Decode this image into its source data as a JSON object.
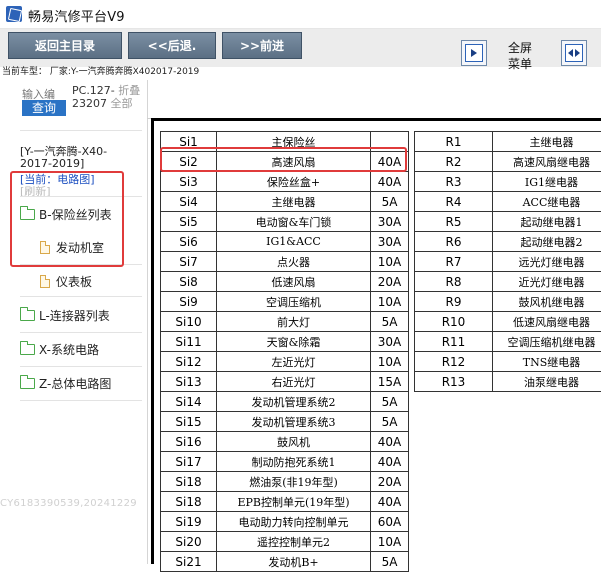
{
  "window": {
    "title": "畅易汽修平台V9"
  },
  "toolbar": {
    "back_main": "返回主目录",
    "back": "<<后退.",
    "forward": ">>前进",
    "fullscreen_line1": "全屏",
    "fullscreen_line2": "菜单"
  },
  "vehicle_line": "当前车型： 厂家:Y-一汽奔腾奔腾X402017-2019",
  "left": {
    "input_label": "输入编",
    "query": "查询",
    "code_line1_a": "PC.127-",
    "code_line1_b": "折叠",
    "code_line2_a": "23207",
    "code_line2_b": "全部",
    "model": "[Y-一汽奔腾-X40-2017-2019]",
    "current_link": "[当前：电路图]",
    "refresh": "[刷新]",
    "tree": [
      {
        "label": "B-保险丝列表"
      },
      {
        "label": "发动机室"
      },
      {
        "label": "仪表板"
      },
      {
        "label": "L-连接器列表"
      },
      {
        "label": "X-系统电路"
      },
      {
        "label": "Z-总体电路图"
      }
    ],
    "watermark": "CY6183390539,20241229"
  },
  "fuse_table_left": [
    [
      "Si1",
      "主保险丝",
      ""
    ],
    [
      "Si2",
      "高速风扇",
      "40A"
    ],
    [
      "Si3",
      "保险丝盒+",
      "40A"
    ],
    [
      "Si4",
      "主继电器",
      "5A"
    ],
    [
      "Si5",
      "电动窗&车门锁",
      "30A"
    ],
    [
      "Si6",
      "IG1&ACC",
      "30A"
    ],
    [
      "Si7",
      "点火器",
      "10A"
    ],
    [
      "Si8",
      "低速风扇",
      "20A"
    ],
    [
      "Si9",
      "空调压缩机",
      "10A"
    ],
    [
      "Si10",
      "前大灯",
      "5A"
    ],
    [
      "Si11",
      "天窗&除霜",
      "30A"
    ],
    [
      "Si12",
      "左近光灯",
      "10A"
    ],
    [
      "Si13",
      "右近光灯",
      "15A"
    ],
    [
      "Si14",
      "发动机管理系统2",
      "5A"
    ],
    [
      "Si15",
      "发动机管理系统3",
      "5A"
    ],
    [
      "Si16",
      "鼓风机",
      "40A"
    ],
    [
      "Si17",
      "制动防抱死系统1",
      "40A"
    ],
    [
      "Si18",
      "燃油泵(非19年型)",
      "20A"
    ],
    [
      "Si18",
      "EPB控制单元(19年型)",
      "40A"
    ],
    [
      "Si19",
      "电动助力转向控制单元",
      "60A"
    ],
    [
      "Si20",
      "遥控控制单元2",
      "10A"
    ],
    [
      "Si21",
      "发动机B+",
      "5A"
    ]
  ],
  "fuse_table_right": [
    [
      "R1",
      "主继电器"
    ],
    [
      "R2",
      "高速风扇继电器"
    ],
    [
      "R3",
      "IG1继电器"
    ],
    [
      "R4",
      "ACC继电器"
    ],
    [
      "R5",
      "起动继电器1"
    ],
    [
      "R6",
      "起动继电器2"
    ],
    [
      "R7",
      "远光灯继电器"
    ],
    [
      "R8",
      "近光灯继电器"
    ],
    [
      "R9",
      "鼓风机继电器"
    ],
    [
      "R10",
      "低速风扇继电器"
    ],
    [
      "R11",
      "空调压缩机继电器"
    ],
    [
      "R12",
      "TNS继电器"
    ],
    [
      "R13",
      "油泵继电器"
    ]
  ]
}
